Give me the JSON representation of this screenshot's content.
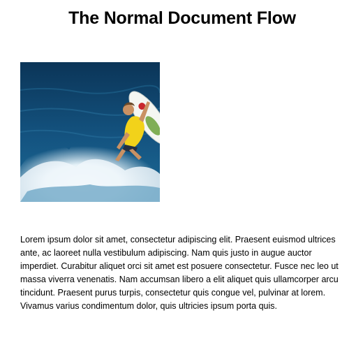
{
  "page": {
    "title": "The Normal Document Flow",
    "image": {
      "description": "surfer-photo",
      "colors": {
        "ocean_deep": "#0e3e63",
        "ocean_mid": "#1a5d85",
        "foam": "#f2f8fb",
        "shirt": "#f2d21a",
        "board": "#f4f6f2"
      }
    },
    "paragraph": "Lorem ipsum dolor sit amet, consectetur adipiscing elit. Praesent euismod ultrices ante, ac laoreet nulla vestibulum adipiscing. Nam quis justo in augue auctor imperdiet. Curabitur aliquet orci sit amet est posuere consectetur. Fusce nec leo ut massa viverra venenatis. Nam accumsan libero a elit aliquet quis ullamcorper arcu tincidunt. Praesent purus turpis, consectetur quis congue vel, pulvinar at lorem. Vivamus varius condimentum dolor, quis ultricies ipsum porta quis."
  }
}
